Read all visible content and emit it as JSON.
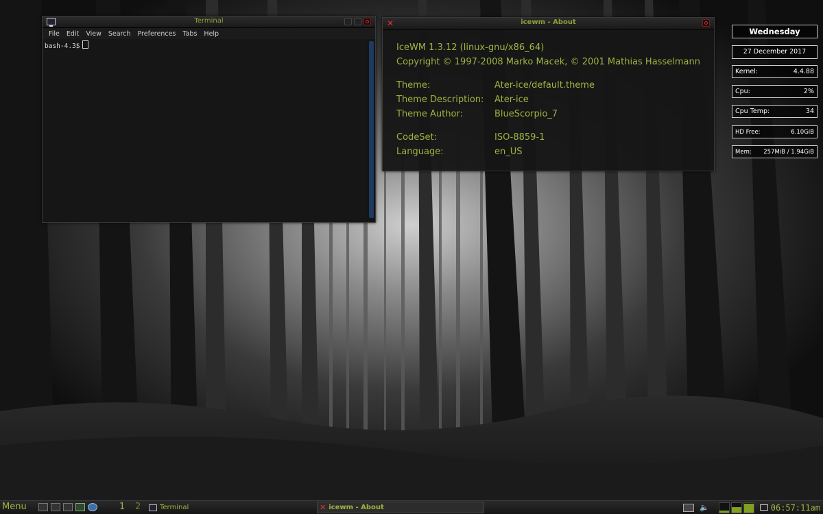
{
  "terminal": {
    "title": "Terminal",
    "menu": [
      "File",
      "Edit",
      "View",
      "Search",
      "Preferences",
      "Tabs",
      "Help"
    ],
    "prompt": "bash-4.3$"
  },
  "about": {
    "title": "icewm - About",
    "version": "IceWM 1.3.12 (linux-gnu/x86_64)",
    "copyright": "Copyright © 1997-2008 Marko Macek, © 2001 Mathias Hasselmann",
    "theme": {
      "label": "Theme:",
      "value": "Ater-ice/default.theme"
    },
    "theme_description": {
      "label": "Theme Description:",
      "value": "Ater-ice"
    },
    "theme_author": {
      "label": "Theme Author:",
      "value": "BlueScorpio_7"
    },
    "codeset": {
      "label": "CodeSet:",
      "value": "ISO-8859-1"
    },
    "language": {
      "label": "Language:",
      "value": "en_US"
    }
  },
  "widgets": {
    "day": "Wednesday",
    "date": "27  December  2017",
    "kernel": {
      "label": "Kernel:",
      "value": "4.4.88"
    },
    "cpu": {
      "label": "Cpu:",
      "value": "2%"
    },
    "cpu_temp": {
      "label": "Cpu  Temp:",
      "value": "34"
    },
    "hd_free": {
      "label": "HD  Free:",
      "value": "6.10GiB"
    },
    "mem": {
      "label": "Mem:",
      "value": "257MiB  /  1.94GiB"
    }
  },
  "taskbar": {
    "menu_label": "Menu",
    "workspaces": [
      "1",
      "2"
    ],
    "tasks": [
      "Terminal",
      "icewm - About"
    ],
    "meters": [
      0.2,
      0.55,
      0.9
    ],
    "clock": "06:57:11am",
    "accent": "#9cb441"
  }
}
